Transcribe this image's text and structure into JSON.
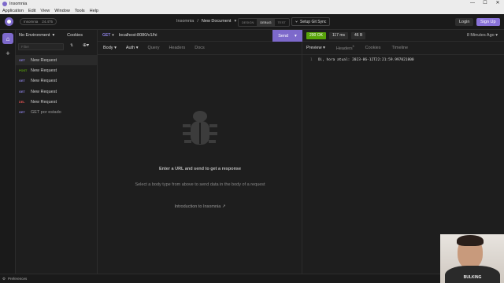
{
  "window": {
    "app_name": "Insomnia",
    "minimize": "—",
    "maximize": "☐",
    "close": "✕"
  },
  "menu": [
    "Application",
    "Edit",
    "View",
    "Window",
    "Tools",
    "Help"
  ],
  "topbar": {
    "project_pill": [
      "Insomnia",
      "24.475"
    ],
    "breadcrumb_root": "Insomnia",
    "breadcrumb_sep": "/",
    "document": "New Document",
    "modes": [
      "DESIGN",
      "DEBUG",
      "TEST"
    ],
    "git_sync": "Setup Git Sync",
    "login": "Login",
    "signup": "Sign Up"
  },
  "sidebar": {
    "environment": "No Environment",
    "cookies": "Cookies",
    "filter_placeholder": "Filter",
    "requests": [
      {
        "method": "GET",
        "name": "New Request",
        "color": "#8a7fe0"
      },
      {
        "method": "POST",
        "name": "New Request",
        "color": "#58a30a"
      },
      {
        "method": "GET",
        "name": "New Request",
        "color": "#8a7fe0"
      },
      {
        "method": "GET",
        "name": "New Request",
        "color": "#8a7fe0"
      },
      {
        "method": "DEL",
        "name": "New Request",
        "color": "#e15251"
      },
      {
        "method": "GET",
        "name": "GET por estado",
        "color": "#8a7fe0"
      }
    ]
  },
  "request": {
    "method": "GET",
    "url": "localhost:8080/v1/hi",
    "send": "Send",
    "tabs": [
      "Body",
      "Auth",
      "Query",
      "Headers",
      "Docs"
    ],
    "empty_title": "Enter a URL and send to get a response",
    "empty_sub": "Select a body type from above to send data in the body of a request",
    "intro_link": "Introduction to Insomnia"
  },
  "response": {
    "status": "200 OK",
    "time": "117 ms",
    "size": "46 B",
    "ago": "8 Minutes Ago",
    "tabs": [
      "Preview",
      "Headers",
      "Cookies",
      "Timeline"
    ],
    "headers_count": "5",
    "line_no": "1",
    "body": "Oi, hora atual: 2023-06-12T22:21:59.997021800"
  },
  "footer": {
    "preferences": "Preferences"
  },
  "webcam": {
    "shirt_text": "BULKING"
  }
}
